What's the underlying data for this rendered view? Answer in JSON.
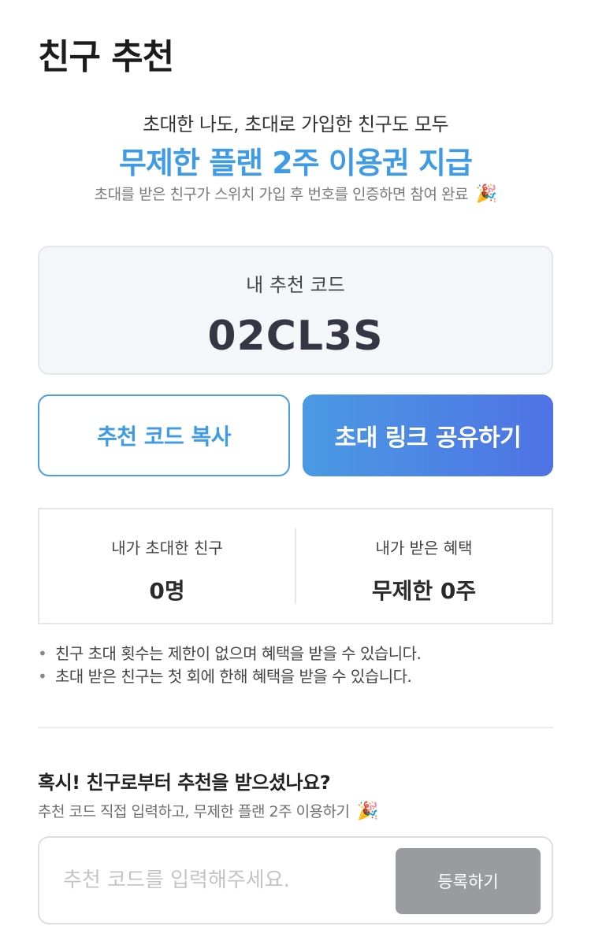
{
  "header": {
    "title": "친구 추천"
  },
  "hero": {
    "line1": "초대한 나도, 초대로 가입한 친구도 모두",
    "highlight": "무제한 플랜 2주 이용권 지급",
    "note": "초대를 받은 친구가 스위치 가입 후 번호를 인증하면 참여 완료",
    "note_emoji": "🎉"
  },
  "code_card": {
    "label": "내 추천 코드",
    "code": "02CL3S"
  },
  "buttons": {
    "copy_label": "추천 코드 복사",
    "share_label": "초대 링크 공유하기"
  },
  "stats": {
    "invited_label": "내가 초대한 친구",
    "invited_value": "0명",
    "benefit_label": "내가 받은 혜택",
    "benefit_value": "무제한 0주"
  },
  "notes": [
    "친구 초대 횟수는 제한이 없으며 혜택을 받을 수 있습니다.",
    "초대 받은 친구는 첫 회에 한해 혜택을 받을 수 있습니다."
  ],
  "register": {
    "title": "혹시! 친구로부터 추천을 받으셨나요?",
    "subtitle": "추천 코드 직접 입력하고, 무제한 플랜 2주 이용하기",
    "subtitle_emoji": "🎉",
    "placeholder": "추천 코드를 입력해주세요.",
    "value": "",
    "button_label": "등록하기"
  },
  "colors": {
    "accent": "#3f9be6",
    "gradient_start": "#4a9ae3",
    "gradient_end": "#4f72e4",
    "disabled_button": "#9a9b9e"
  }
}
